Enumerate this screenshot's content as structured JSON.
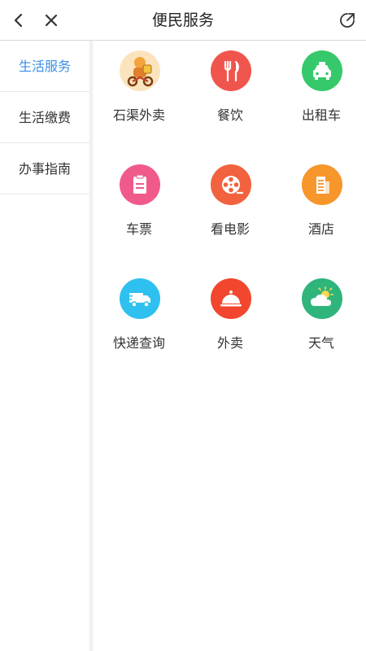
{
  "header": {
    "title": "便民服务",
    "back_icon": "chevron-left-icon",
    "close_icon": "close-icon",
    "share_icon": "share-icon"
  },
  "sidebar": {
    "items": [
      {
        "label": "生活服务",
        "active": true
      },
      {
        "label": "生活缴费",
        "active": false
      },
      {
        "label": "办事指南",
        "active": false
      }
    ],
    "active_color": "#3a8ee6"
  },
  "services": [
    {
      "label": "石渠外卖",
      "icon": "delivery-rider-icon",
      "color": "#f3a43b"
    },
    {
      "label": "餐饮",
      "icon": "fork-knife-icon",
      "color": "#f0554d"
    },
    {
      "label": "出租车",
      "icon": "taxi-icon",
      "color": "#35c96b"
    },
    {
      "label": "车票",
      "icon": "ticket-icon",
      "color": "#f05a8a"
    },
    {
      "label": "看电影",
      "icon": "film-reel-icon",
      "color": "#f2623f"
    },
    {
      "label": "酒店",
      "icon": "hotel-icon",
      "color": "#f7962b"
    },
    {
      "label": "快递查询",
      "icon": "delivery-truck-icon",
      "color": "#2ec0ef"
    },
    {
      "label": "外卖",
      "icon": "food-cloche-icon",
      "color": "#f2472e"
    },
    {
      "label": "天气",
      "icon": "weather-cloud-sun-icon",
      "color": "#2fb57c"
    }
  ]
}
